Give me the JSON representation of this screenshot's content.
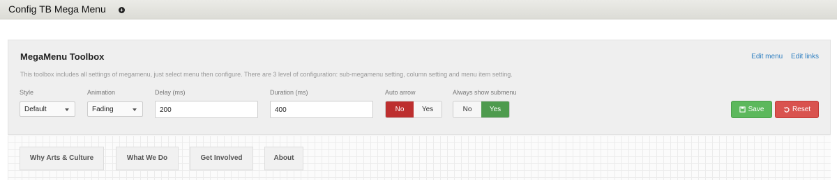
{
  "header": {
    "title": "Config TB Mega Menu",
    "add_icon": "plus-circle-icon"
  },
  "toolbox": {
    "title": "MegaMenu Toolbox",
    "links": [
      "Edit menu",
      "Edit links"
    ],
    "description": "This toolbox includes all settings of megamenu, just select menu then configure. There are 3 level of configuration: sub-megamenu setting, column setting and menu item setting.",
    "style": {
      "label": "Style",
      "value": "Default"
    },
    "animation": {
      "label": "Animation",
      "value": "Fading"
    },
    "delay": {
      "label": "Delay (ms)",
      "value": "200"
    },
    "duration": {
      "label": "Duration (ms)",
      "value": "400"
    },
    "auto_arrow": {
      "label": "Auto arrow",
      "no": "No",
      "yes": "Yes",
      "selected": "No"
    },
    "always_show_submenu": {
      "label": "Always show submenu",
      "no": "No",
      "yes": "Yes",
      "selected": "Yes"
    },
    "save_label": "Save",
    "reset_label": "Reset",
    "colors": {
      "save": "#5cb85c",
      "reset": "#d9534f",
      "link": "#2f7fc1"
    }
  },
  "menu": {
    "items": [
      "Why Arts & Culture",
      "What We Do",
      "Get Involved",
      "About"
    ]
  }
}
